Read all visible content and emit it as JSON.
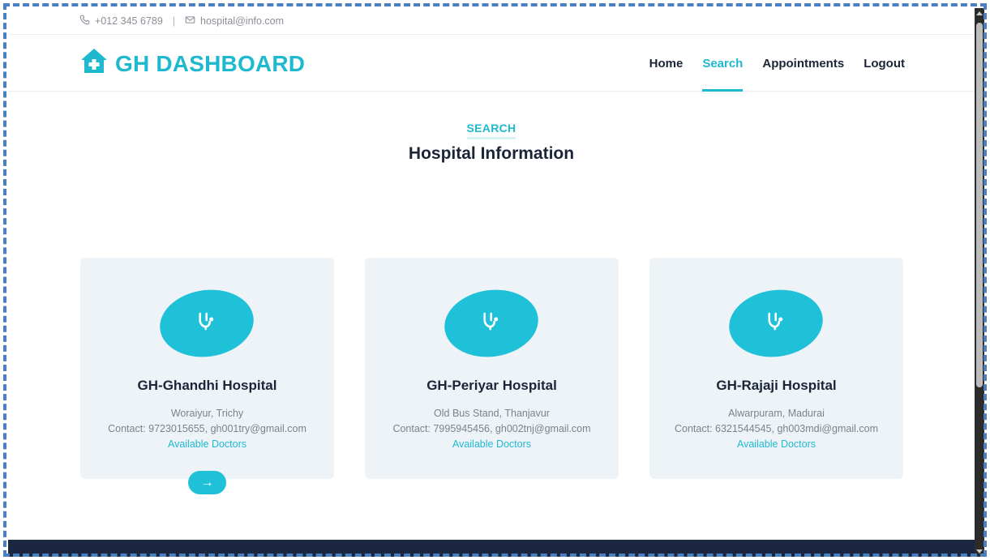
{
  "topbar": {
    "phone": "+012 345 6789",
    "separator": "|",
    "email": "hospital@info.com"
  },
  "brand": {
    "name": "GH DASHBOARD",
    "icon": "house-medical-icon",
    "color": "#1fb9cf"
  },
  "nav": {
    "items": [
      {
        "label": "Home",
        "active": false
      },
      {
        "label": "Search",
        "active": true
      },
      {
        "label": "Appointments",
        "active": false
      },
      {
        "label": "Logout",
        "active": false
      }
    ]
  },
  "section": {
    "eyebrow": "SEARCH",
    "title": "Hospital Information"
  },
  "hospitals": [
    {
      "name": "GH-Ghandhi Hospital",
      "address": "Woraiyur, Trichy",
      "contact": "Contact: 9723015655, gh001try@gmail.com",
      "link": "Available Doctors"
    },
    {
      "name": "GH-Periyar Hospital",
      "address": "Old Bus Stand, Thanjavur",
      "contact": "Contact: 7995945456, gh002tnj@gmail.com",
      "link": "Available Doctors"
    },
    {
      "name": "GH-Rajaji Hospital",
      "address": "Alwarpuram, Madurai",
      "contact": "Contact: 6321544545, gh003mdi@gmail.com",
      "link": "Available Doctors"
    }
  ],
  "arrow_button": {
    "label": "→"
  },
  "colors": {
    "accent": "#1fb9cf",
    "card_bg": "#eef3f8",
    "text_dark": "#1c2538",
    "footer_bg": "#1b2641"
  }
}
